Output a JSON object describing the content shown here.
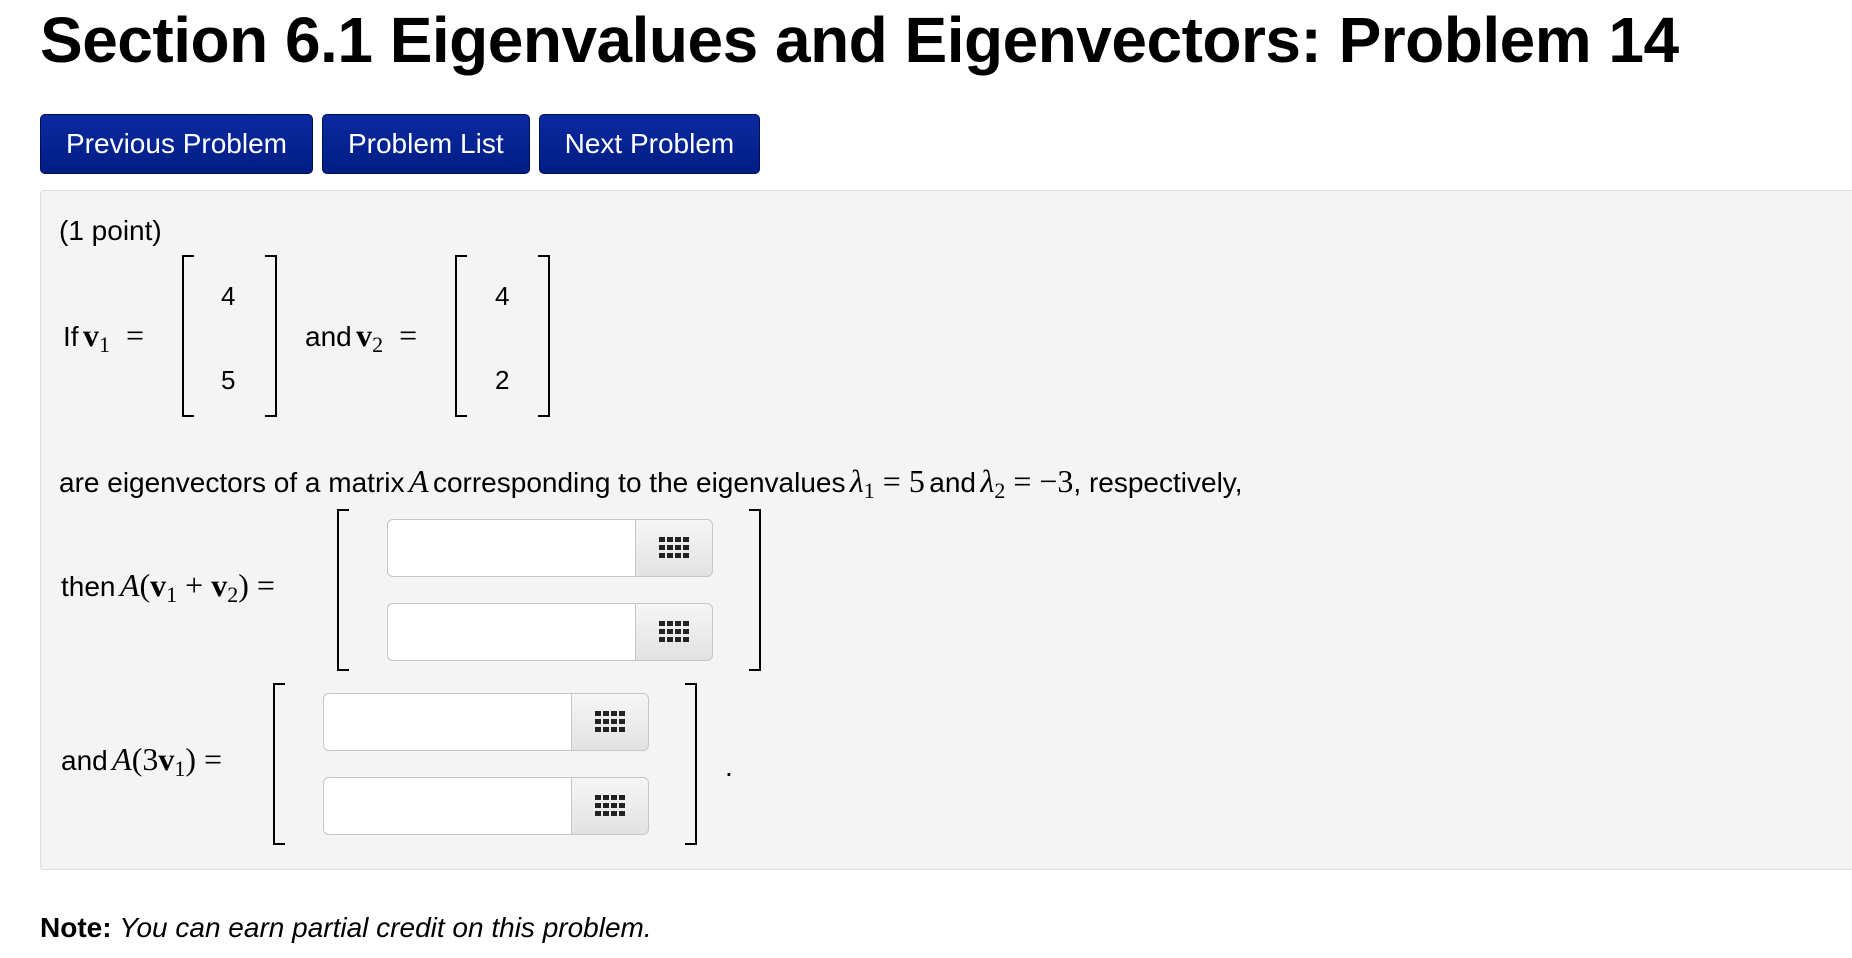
{
  "page_title": "Section 6.1 Eigenvalues and Eigenvectors: Problem 14",
  "nav": {
    "previous": "Previous Problem",
    "list": "Problem List",
    "next": "Next Problem"
  },
  "problem": {
    "points": "(1 point)",
    "if_text": "If",
    "and_text": "and",
    "v1_entries": [
      "4",
      "5"
    ],
    "v2_entries": [
      "4",
      "2"
    ],
    "statement_prefix": "are eigenvectors of a matrix",
    "statement_matrix": "A",
    "statement_mid": "corresponding to the eigenvalues",
    "lambda1_value": "5",
    "lambda2_value": "−3",
    "statement_suffix": ", respectively,",
    "then_text": "then",
    "and2_text": "and",
    "answers": [
      "",
      "",
      "",
      ""
    ],
    "end_period": "."
  },
  "note": {
    "label": "Note:",
    "text": "You can earn partial credit on this problem."
  },
  "icons": {
    "answer_button": "grid-keypad-icon"
  }
}
